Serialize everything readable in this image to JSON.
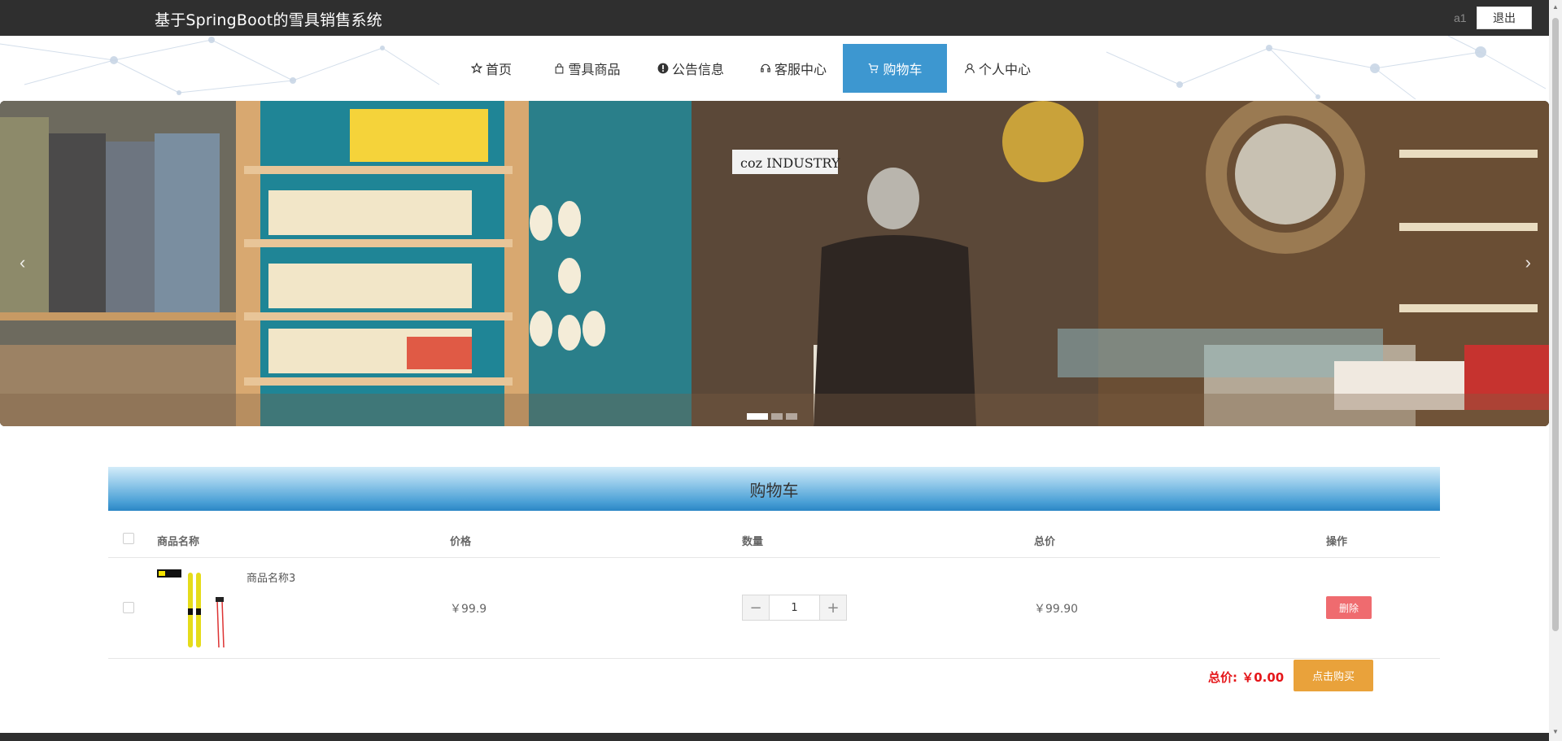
{
  "header": {
    "site_title": "基于SpringBoot的雪具销售系统",
    "username": "a1",
    "logout_label": "退出"
  },
  "nav": {
    "items": [
      {
        "label": "首页",
        "icon": "star-icon"
      },
      {
        "label": "雪具商品",
        "icon": "bag-icon"
      },
      {
        "label": "公告信息",
        "icon": "exclamation-icon"
      },
      {
        "label": "客服中心",
        "icon": "headset-icon"
      },
      {
        "label": "购物车",
        "icon": "cart-icon",
        "active": true
      },
      {
        "label": "个人中心",
        "icon": "user-icon"
      }
    ]
  },
  "banner": {
    "store_sign": "coz INDUSTRY",
    "prev_icon": "chevron-left-icon",
    "next_icon": "chevron-right-icon",
    "slide_count": 3,
    "active_slide": 0
  },
  "cart": {
    "title": "购物车",
    "columns": {
      "name": "商品名称",
      "price": "价格",
      "qty": "数量",
      "subtotal": "总价",
      "action": "操作"
    },
    "items": [
      {
        "name": "商品名称3",
        "price": "￥99.9",
        "quantity": "1",
        "subtotal": "￥99.90",
        "delete_label": "删除",
        "image_icon": "ski-product-icon"
      }
    ],
    "decrement_label": "−",
    "increment_label": "+",
    "total_label": "总价: ￥0.00",
    "buy_label": "点击购买"
  },
  "colors": {
    "topbar": "#2f2f2f",
    "nav_active": "#3d97d0",
    "delete": "#ef6b6f",
    "buy": "#e9a23b",
    "total": "#e5161a"
  }
}
